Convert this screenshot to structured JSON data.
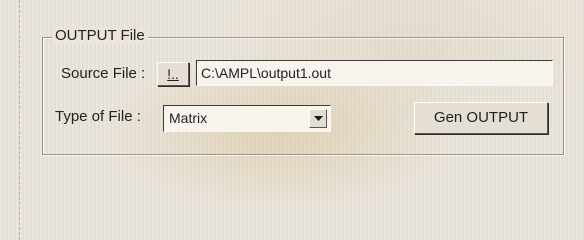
{
  "group": {
    "title": "OUTPUT File"
  },
  "source": {
    "label": "Source File :",
    "browse_label": "!..",
    "path_value": "C:\\AMPL\\output1.out"
  },
  "file_type": {
    "label": "Type of File :",
    "selected": "Matrix"
  },
  "actions": {
    "generate_label": "Gen OUTPUT"
  },
  "icons": {
    "dropdown": "chevron-down-icon"
  }
}
